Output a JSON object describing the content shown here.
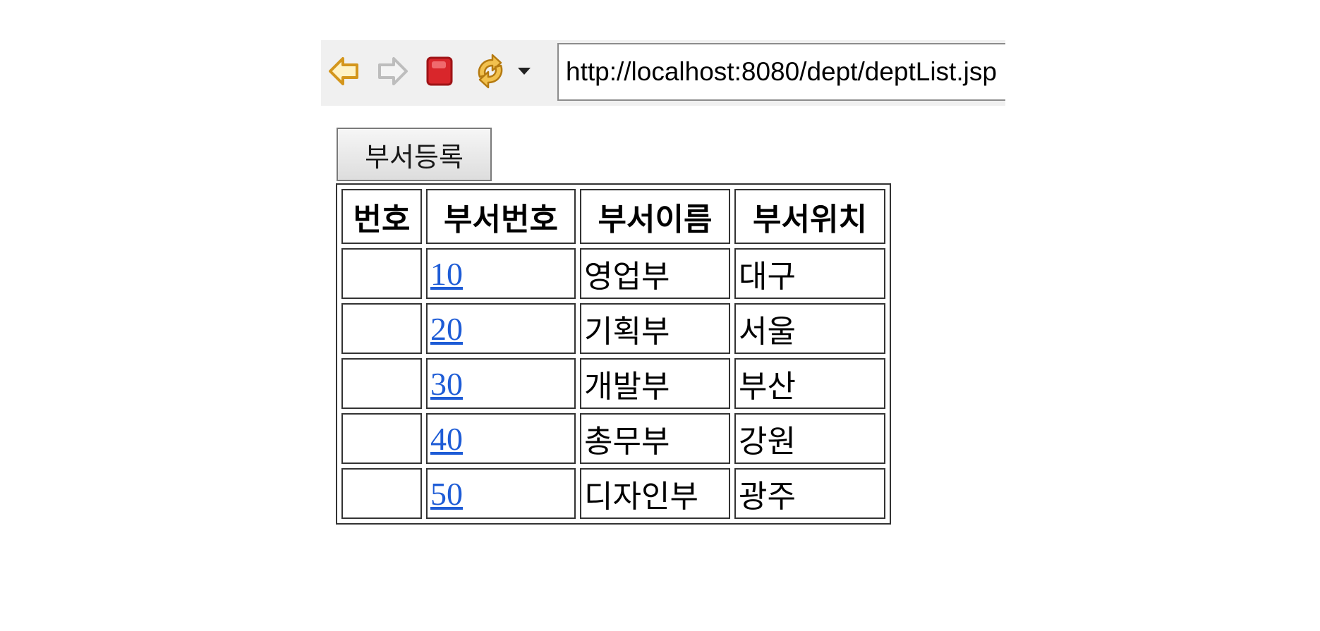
{
  "browser": {
    "url": "http://localhost:8080/dept/deptList.jsp",
    "icons": {
      "back": "back-arrow-icon",
      "forward": "forward-arrow-icon",
      "stop": "stop-icon",
      "refresh": "refresh-icon",
      "dropdown": "dropdown-triangle-icon"
    },
    "colors": {
      "toolbar_bg": "#f0f0f0",
      "back_arrow": "#e3a52a",
      "forward_arrow": "#c8c8c8",
      "stop": "#d9262b",
      "refresh": "#e3a52a"
    }
  },
  "page": {
    "register_button_label": "부서등록",
    "table": {
      "headers": [
        "번호",
        "부서번호",
        "부서이름",
        "부서위치"
      ],
      "rows": [
        {
          "num": "",
          "deptno": "10",
          "dname": "영업부",
          "loc": "대구"
        },
        {
          "num": "",
          "deptno": "20",
          "dname": "기획부",
          "loc": "서울"
        },
        {
          "num": "",
          "deptno": "30",
          "dname": "개발부",
          "loc": "부산"
        },
        {
          "num": "",
          "deptno": "40",
          "dname": "총무부",
          "loc": "강원"
        },
        {
          "num": "",
          "deptno": "50",
          "dname": "디자인부",
          "loc": "광주"
        }
      ]
    },
    "colors": {
      "link": "#1e5cd6",
      "border": "#333333"
    }
  }
}
